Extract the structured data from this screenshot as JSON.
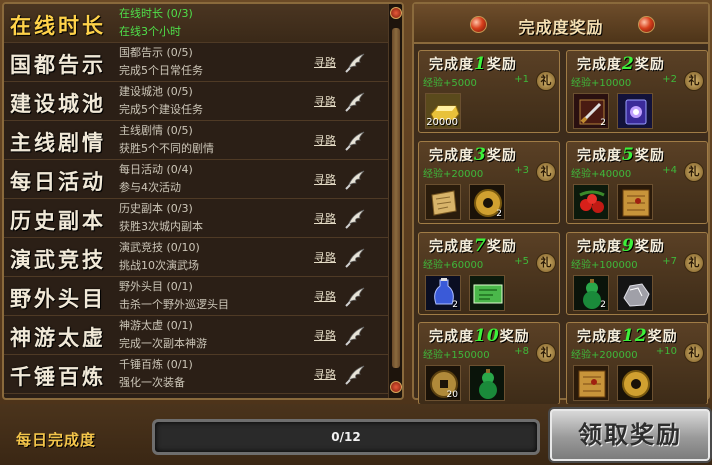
{
  "tasks": [
    {
      "name": "在线时长",
      "title": "在线时长",
      "progress": "(0/3)",
      "desc": "在线3个小时",
      "guide": ""
    },
    {
      "name": "国都告示",
      "title": "国都告示",
      "progress": "(0/5)",
      "desc": "完成5个日常任务",
      "guide": "寻路"
    },
    {
      "name": "建设城池",
      "title": "建设城池",
      "progress": "(0/5)",
      "desc": "完成5个建设任务",
      "guide": "寻路"
    },
    {
      "name": "主线剧情",
      "title": "主线剧情",
      "progress": "(0/5)",
      "desc": "获胜5个不同的剧情",
      "guide": "寻路"
    },
    {
      "name": "每日活动",
      "title": "每日活动",
      "progress": "(0/4)",
      "desc": "参与4次活动",
      "guide": "寻路"
    },
    {
      "name": "历史副本",
      "title": "历史副本",
      "progress": "(0/3)",
      "desc": "获胜3次城内副本",
      "guide": "寻路"
    },
    {
      "name": "演武竞技",
      "title": "演武竞技",
      "progress": "(0/10)",
      "desc": "挑战10次演武场",
      "guide": "寻路"
    },
    {
      "name": "野外头目",
      "title": "野外头目",
      "progress": "(0/1)",
      "desc": "击杀一个野外巡逻头目",
      "guide": "寻路"
    },
    {
      "name": "神游太虚",
      "title": "神游太虚",
      "progress": "(0/1)",
      "desc": "完成一次副本神游",
      "guide": "寻路"
    },
    {
      "name": "千锤百炼",
      "title": "千锤百炼",
      "progress": "(0/1)",
      "desc": "强化一次装备",
      "guide": "寻路"
    }
  ],
  "reward_panel": {
    "title": "完成度奖励",
    "card_prefix": "完成度",
    "card_suffix": "奖励",
    "gift_glyph": "礼"
  },
  "rewards": [
    {
      "level": "1",
      "exp": "经验+5000",
      "plus": "+1",
      "items": [
        {
          "icon": "gold-ingot-icon",
          "count": "20000"
        }
      ]
    },
    {
      "level": "2",
      "exp": "经验+10000",
      "plus": "+2",
      "items": [
        {
          "icon": "sword-scroll-icon",
          "count": "2"
        },
        {
          "icon": "magic-tome-icon",
          "count": ""
        }
      ]
    },
    {
      "level": "3",
      "exp": "经验+20000",
      "plus": "+3",
      "items": [
        {
          "icon": "map-scroll-icon",
          "count": ""
        },
        {
          "icon": "jade-coin-icon",
          "count": "2"
        }
      ]
    },
    {
      "level": "5",
      "exp": "经验+40000",
      "plus": "+4",
      "items": [
        {
          "icon": "red-berries-icon",
          "count": ""
        },
        {
          "icon": "treasure-map-icon",
          "count": ""
        }
      ]
    },
    {
      "level": "7",
      "exp": "经验+60000",
      "plus": "+5",
      "items": [
        {
          "icon": "blue-vase-icon",
          "count": "2"
        },
        {
          "icon": "green-ticket-icon",
          "count": ""
        }
      ]
    },
    {
      "level": "9",
      "exp": "经验+100000",
      "plus": "+7",
      "items": [
        {
          "icon": "green-gourd-icon",
          "count": "2"
        },
        {
          "icon": "ore-chunk-icon",
          "count": ""
        }
      ]
    },
    {
      "level": "10",
      "exp": "经验+150000",
      "plus": "+8",
      "items": [
        {
          "icon": "copper-coin-icon",
          "count": "20"
        },
        {
          "icon": "green-gourd-icon",
          "count": ""
        }
      ]
    },
    {
      "level": "12",
      "exp": "经验+200000",
      "plus": "+10",
      "items": [
        {
          "icon": "treasure-map-icon",
          "count": ""
        },
        {
          "icon": "jade-coin-icon",
          "count": ""
        }
      ]
    }
  ],
  "footer": {
    "daily_label": "每日完成度",
    "progress_text": "0/12",
    "progress_fraction": 0,
    "claim_label": "领取奖励"
  }
}
